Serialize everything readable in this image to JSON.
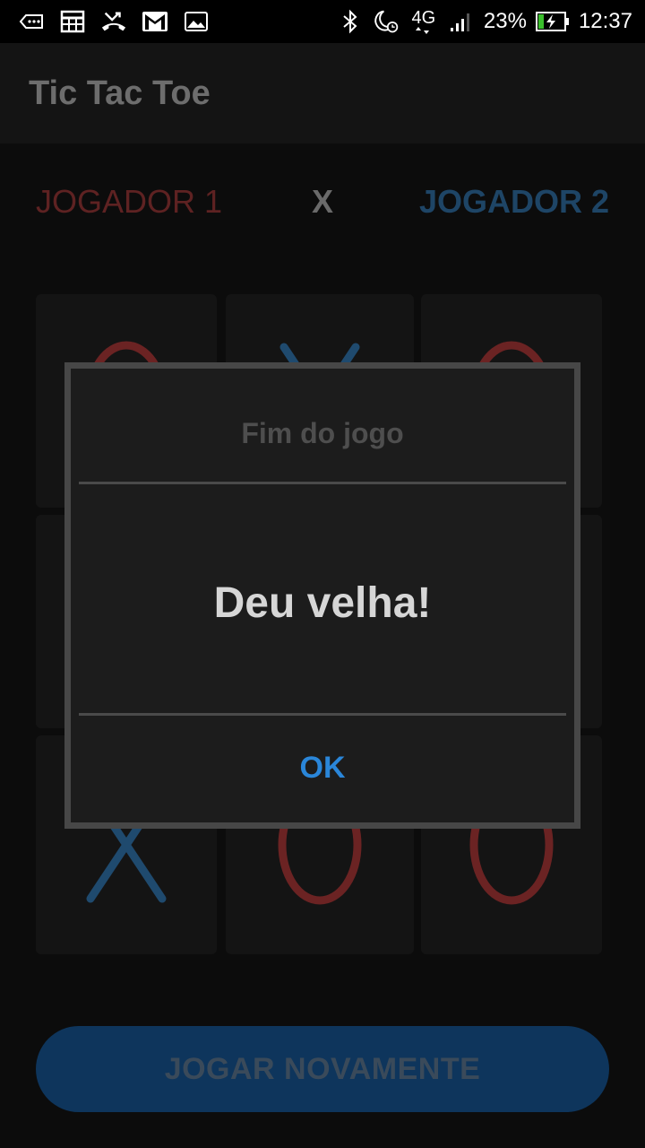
{
  "status_bar": {
    "icons_left": [
      "voicemail-icon",
      "calendar-grid-icon",
      "missed-call-icon",
      "gmail-icon",
      "image-icon"
    ],
    "icons_right": [
      "bluetooth-icon",
      "do-not-disturb-alarm-icon",
      "4g-icon",
      "signal-icon",
      "battery-charging-icon"
    ],
    "network": "4G",
    "battery_percent": "23%",
    "battery_level": 0.23,
    "time": "12:37"
  },
  "app_bar": {
    "title": "Tic Tac Toe"
  },
  "players": {
    "player1": "JOGADOR 1",
    "versus": "X",
    "player2": "JOGADOR 2",
    "player1_color": "#5e2222",
    "player2_color": "#1e4566"
  },
  "board": {
    "cells": [
      "O",
      "X",
      "O",
      "",
      "",
      "",
      "X",
      "O",
      "O"
    ],
    "o_color": "#6b2323",
    "x_color": "#1f4a6e"
  },
  "dialog": {
    "title": "Fim do jogo",
    "message": "Deu velha!",
    "ok_label": "OK",
    "ok_color": "#2a86d9"
  },
  "actions": {
    "play_again_label": "JOGAR NOVAMENTE"
  }
}
